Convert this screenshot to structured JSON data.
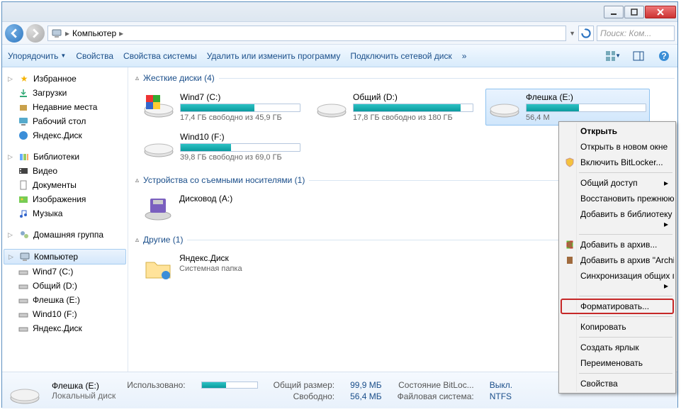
{
  "breadcrumb": {
    "root_icon": "computer-icon",
    "root": "Компьютер",
    "arrow": "▸"
  },
  "search": {
    "placeholder": "Поиск: Ком..."
  },
  "toolbar": {
    "organize": "Упорядочить",
    "properties": "Свойства",
    "sysprops": "Свойства системы",
    "uninstall": "Удалить или изменить программу",
    "mapdrive": "Подключить сетевой диск",
    "more": "»"
  },
  "sidebar": {
    "favorites": {
      "label": "Избранное",
      "items": [
        "Загрузки",
        "Недавние места",
        "Рабочий стол",
        "Яндекс.Диск"
      ]
    },
    "libraries": {
      "label": "Библиотеки",
      "items": [
        "Видео",
        "Документы",
        "Изображения",
        "Музыка"
      ]
    },
    "homegroup": "Домашняя группа",
    "computer": {
      "label": "Компьютер",
      "items": [
        "Wind7 (C:)",
        "Общий (D:)",
        "Флешка (E:)",
        "Wind10 (F:)",
        "Яндекс.Диск"
      ]
    }
  },
  "groups": {
    "hdd": {
      "title": "Жесткие диски (4)",
      "drives": [
        {
          "name": "Wind7 (C:)",
          "free": "17,4 ГБ свободно из 45,9 ГБ",
          "fill": 62,
          "sys": true
        },
        {
          "name": "Общий (D:)",
          "free": "17,8 ГБ свободно из 180 ГБ",
          "fill": 90
        },
        {
          "name": "Флешка (E:)",
          "free": "56,4 М",
          "fill": 44,
          "selected": true
        },
        {
          "name": "Wind10 (F:)",
          "free": "39,8 ГБ свободно из 69,0 ГБ",
          "fill": 42
        }
      ]
    },
    "removable": {
      "title": "Устройства со съемными носителями (1)",
      "items": [
        {
          "name": "Дисковод (A:)"
        }
      ]
    },
    "other": {
      "title": "Другие (1)",
      "items": [
        {
          "name": "Яндекс.Диск",
          "sub": "Системная папка"
        }
      ]
    }
  },
  "status": {
    "title": "Флешка (E:)",
    "sub": "Локальный диск",
    "used_lbl": "Использовано:",
    "used_val": "",
    "total_lbl": "Общий размер:",
    "total_val": "99,9 МБ",
    "bitlock_lbl": "Состояние BitLoc...",
    "bitlock_val": "Выкл.",
    "free_lbl": "Свободно:",
    "free_val": "56,4 МБ",
    "fs_lbl": "Файловая система:",
    "fs_val": "NTFS"
  },
  "context": {
    "open": "Открыть",
    "open_new": "Открыть в новом окне",
    "bitlocker": "Включить BitLocker...",
    "share": "Общий доступ",
    "restore": "Восстановить прежнюю...",
    "addlib": "Добавить в библиотеку",
    "addarch": "Добавить в архив...",
    "addarch2": "Добавить в архив \"Archiv",
    "sync": "Синхронизация общих п",
    "format": "Форматировать...",
    "copy": "Копировать",
    "shortcut": "Создать ярлык",
    "rename": "Переименовать",
    "props": "Свойства"
  }
}
